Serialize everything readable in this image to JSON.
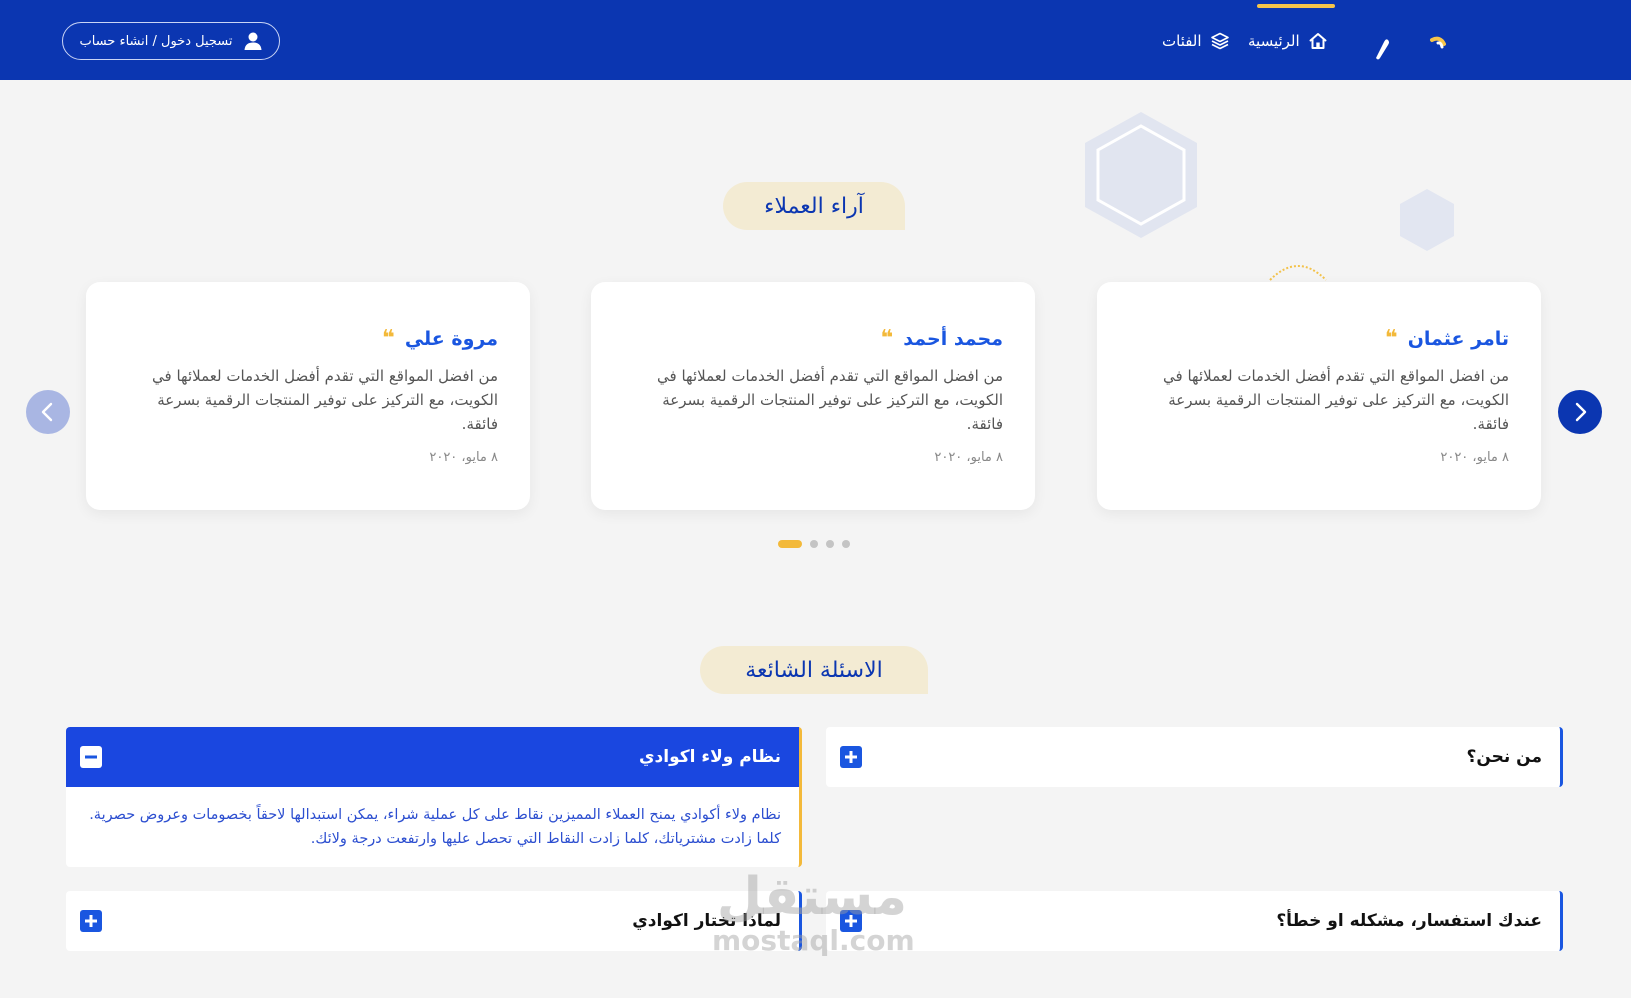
{
  "header": {
    "login_label": "تسجيل دخول / انشاء حساب",
    "nav": [
      {
        "label": "الرئيسية",
        "icon": "home-icon",
        "active": true
      },
      {
        "label": "الفئات",
        "icon": "layers-icon",
        "active": false
      }
    ],
    "brand_color": "#0b36b1",
    "accent_color": "#f6c44a"
  },
  "testimonials": {
    "title": "آراء العملاء",
    "cards": [
      {
        "name": "تامر عثمان",
        "text": "من افضل المواقع التي تقدم أفضل الخدمات لعملائها في الكويت، مع التركيز على توفير المنتجات الرقمية بسرعة فائقة.",
        "date": "٨ مايو، ٢٠٢٠"
      },
      {
        "name": "محمد أحمد",
        "text": "من افضل المواقع التي تقدم أفضل الخدمات لعملائها في الكويت، مع التركيز على توفير المنتجات الرقمية بسرعة فائقة.",
        "date": "٨ مايو، ٢٠٢٠"
      },
      {
        "name": "مروة علي",
        "text": "من افضل المواقع التي تقدم أفضل الخدمات لعملائها في الكويت، مع التركيز على توفير المنتجات الرقمية بسرعة فائقة.",
        "date": "٨ مايو، ٢٠٢٠"
      }
    ],
    "quote_glyph": "❝",
    "dots_count": 4,
    "active_dot": 0
  },
  "faq": {
    "title": "الاسئلة الشائعة",
    "items": [
      {
        "question": "من نحن؟",
        "open": false
      },
      {
        "question": "نظام ولاء اكوادي",
        "open": true,
        "answer": "نظام ولاء أكوادي يمنح العملاء المميزين نقاط على كل عملية شراء، يمكن استبدالها لاحقاً بخصومات وعروض حصرية. كلما زادت مشترياتك، كلما زادت النقاط التي تحصل عليها وارتفعت درجة ولائك."
      },
      {
        "question": "عندك استفسار، مشكله او خطأ؟",
        "open": false
      },
      {
        "question": "لماذا تختار اكوادي",
        "open": false
      }
    ]
  },
  "watermark": {
    "arabic": "مستقل",
    "latin": "mostaql.com"
  }
}
